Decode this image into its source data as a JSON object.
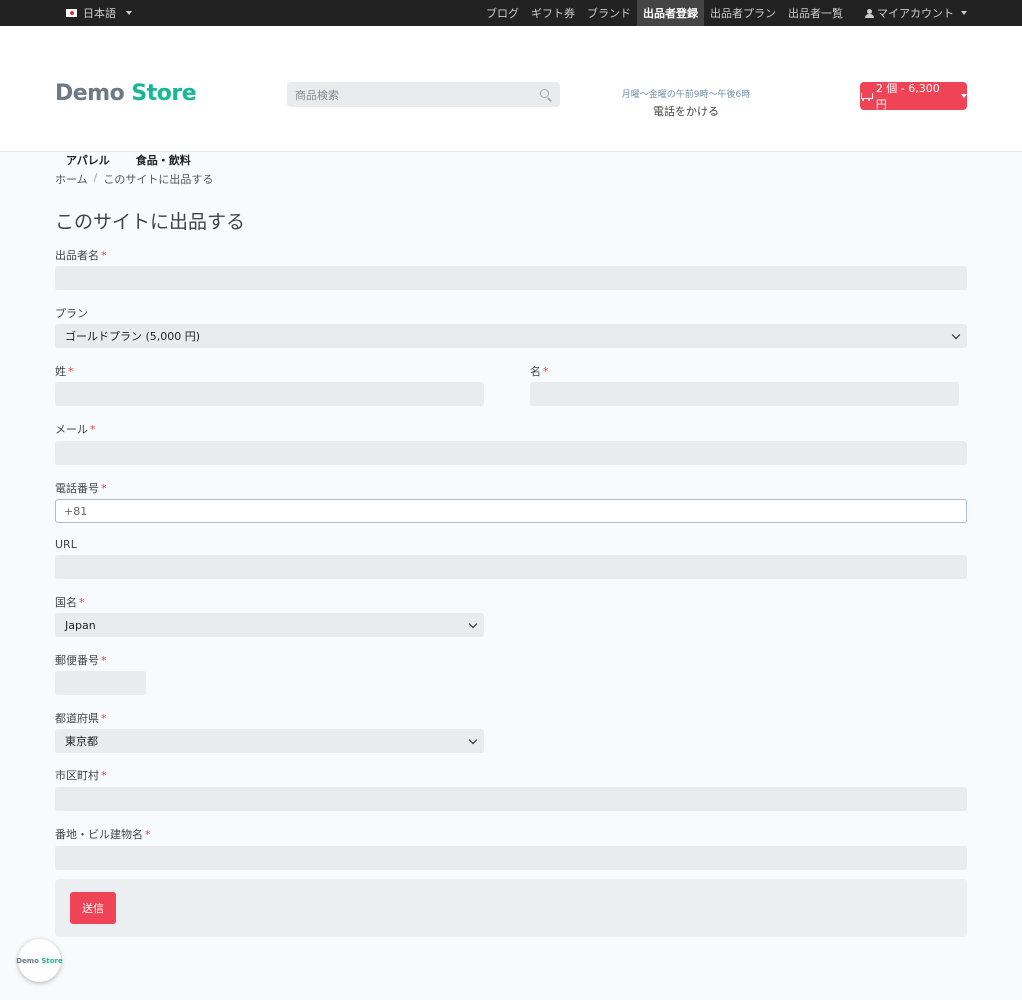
{
  "topbar": {
    "language": "日本語",
    "nav": [
      {
        "label": "ブログ",
        "active": false
      },
      {
        "label": "ギフト券",
        "active": false
      },
      {
        "label": "ブランド",
        "active": false
      },
      {
        "label": "出品者登録",
        "active": true
      },
      {
        "label": "出品者プラン",
        "active": false
      },
      {
        "label": "出品者一覧",
        "active": false
      }
    ],
    "account": "マイアカウント"
  },
  "header": {
    "logo_demo": "Demo",
    "logo_store": "Store",
    "search_placeholder": "商品検索",
    "hours": "月曜〜金曜の午前9時〜午後6時",
    "call": "電話をかける",
    "cart": "2 個 - 6,300 円"
  },
  "categories": [
    "アパレル",
    "食品・飲料"
  ],
  "breadcrumb": {
    "home": "ホーム",
    "sep": "/",
    "current": "このサイトに出品する"
  },
  "page_title": "このサイトに出品する",
  "form": {
    "seller_name": {
      "label": "出品者名",
      "value": ""
    },
    "plan": {
      "label": "プラン",
      "value": "ゴールドプラン (5,000 円)"
    },
    "last_name": {
      "label": "姓",
      "value": ""
    },
    "first_name": {
      "label": "名",
      "value": ""
    },
    "email": {
      "label": "メール",
      "value": ""
    },
    "phone": {
      "label": "電話番号",
      "value": "+81"
    },
    "url": {
      "label": "URL",
      "value": ""
    },
    "country": {
      "label": "国名",
      "value": "Japan"
    },
    "postal": {
      "label": "郵便番号",
      "value": ""
    },
    "prefecture": {
      "label": "都道府県",
      "value": "東京都"
    },
    "city": {
      "label": "市区町村",
      "value": ""
    },
    "address": {
      "label": "番地・ビル建物名",
      "value": ""
    },
    "required_mark": "*",
    "submit": "送信"
  },
  "badge": {
    "demo": "Demo",
    "store": "Store"
  },
  "colors": {
    "accent": "#ee4455",
    "brand_green": "#17b896",
    "topbar": "#222222"
  }
}
